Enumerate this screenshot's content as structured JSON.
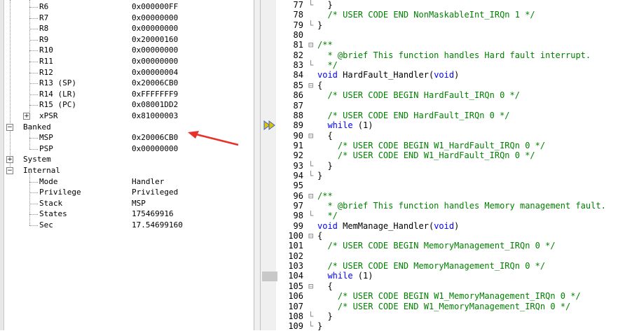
{
  "registers": {
    "rows": [
      {
        "name": "R6",
        "value": "0x000000FF"
      },
      {
        "name": "R7",
        "value": "0x00000000"
      },
      {
        "name": "R8",
        "value": "0x00000000"
      },
      {
        "name": "R9",
        "value": "0x20000160"
      },
      {
        "name": "R10",
        "value": "0x00000000"
      },
      {
        "name": "R11",
        "value": "0x00000000"
      },
      {
        "name": "R12",
        "value": "0x00000004"
      },
      {
        "name": "R13 (SP)",
        "value": "0x20006CB0"
      },
      {
        "name": "R14 (LR)",
        "value": "0xFFFFFFF9"
      },
      {
        "name": "R15 (PC)",
        "value": "0x08001DD2"
      },
      {
        "name": "xPSR",
        "value": "0x81000003"
      }
    ],
    "banked": {
      "label": "Banked",
      "rows": [
        {
          "name": "MSP",
          "value": "0x20006CB0"
        },
        {
          "name": "PSP",
          "value": "0x00000000"
        }
      ]
    },
    "system_label": "System",
    "internal": {
      "label": "Internal",
      "rows": [
        {
          "name": "Mode",
          "value": "Handler"
        },
        {
          "name": "Privilege",
          "value": "Privileged"
        },
        {
          "name": "Stack",
          "value": "MSP"
        },
        {
          "name": "States",
          "value": "175469916"
        },
        {
          "name": "Sec",
          "value": "17.54699160"
        }
      ]
    }
  },
  "code": {
    "lines": [
      {
        "n": "77",
        "fold": "└",
        "t": "  }"
      },
      {
        "n": "78",
        "fold": "",
        "t": "  /* USER CODE END NonMaskableInt_IRQn 1 */"
      },
      {
        "n": "79",
        "fold": "└",
        "t": "}"
      },
      {
        "n": "80",
        "fold": "",
        "t": ""
      },
      {
        "n": "81",
        "fold": "⊟",
        "t": "/**"
      },
      {
        "n": "82",
        "fold": "",
        "t": "  * @brief This function handles Hard fault interrupt."
      },
      {
        "n": "83",
        "fold": "└",
        "t": "  */"
      },
      {
        "n": "84",
        "fold": "",
        "t": "void HardFault_Handler(void)"
      },
      {
        "n": "85",
        "fold": "⊟",
        "t": "{"
      },
      {
        "n": "86",
        "fold": "",
        "t": "  /* USER CODE BEGIN HardFault_IRQn 0 */"
      },
      {
        "n": "87",
        "fold": "",
        "t": ""
      },
      {
        "n": "88",
        "fold": "",
        "t": "  /* USER CODE END HardFault_IRQn 0 */"
      },
      {
        "n": "89",
        "fold": "",
        "t": "  while (1)"
      },
      {
        "n": "90",
        "fold": "⊟",
        "t": "  {"
      },
      {
        "n": "91",
        "fold": "",
        "t": "    /* USER CODE BEGIN W1_HardFault_IRQn 0 */"
      },
      {
        "n": "92",
        "fold": "",
        "t": "    /* USER CODE END W1_HardFault_IRQn 0 */"
      },
      {
        "n": "93",
        "fold": "└",
        "t": "  }"
      },
      {
        "n": "94",
        "fold": "└",
        "t": "}"
      },
      {
        "n": "95",
        "fold": "",
        "t": ""
      },
      {
        "n": "96",
        "fold": "⊟",
        "t": "/**"
      },
      {
        "n": "97",
        "fold": "",
        "t": "  * @brief This function handles Memory management fault."
      },
      {
        "n": "98",
        "fold": "└",
        "t": "  */"
      },
      {
        "n": "99",
        "fold": "",
        "t": "void MemManage_Handler(void)"
      },
      {
        "n": "100",
        "fold": "⊟",
        "t": "{"
      },
      {
        "n": "101",
        "fold": "",
        "t": "  /* USER CODE BEGIN MemoryManagement_IRQn 0 */"
      },
      {
        "n": "102",
        "fold": "",
        "t": ""
      },
      {
        "n": "103",
        "fold": "",
        "t": "  /* USER CODE END MemoryManagement_IRQn 0 */"
      },
      {
        "n": "104",
        "fold": "",
        "t": "  while (1)"
      },
      {
        "n": "105",
        "fold": "⊟",
        "t": "  {"
      },
      {
        "n": "106",
        "fold": "",
        "t": "    /* USER CODE BEGIN W1_MemoryManagement_IRQn 0 */"
      },
      {
        "n": "107",
        "fold": "",
        "t": "    /* USER CODE END W1_MemoryManagement_IRQn 0 */"
      },
      {
        "n": "108",
        "fold": "└",
        "t": "  }"
      },
      {
        "n": "109",
        "fold": "└",
        "t": "}"
      }
    ]
  },
  "colors": {
    "comment": "#008000",
    "keyword": "#0000ff",
    "arrow": "#e8312a",
    "exec_marker": "#e0c000"
  }
}
